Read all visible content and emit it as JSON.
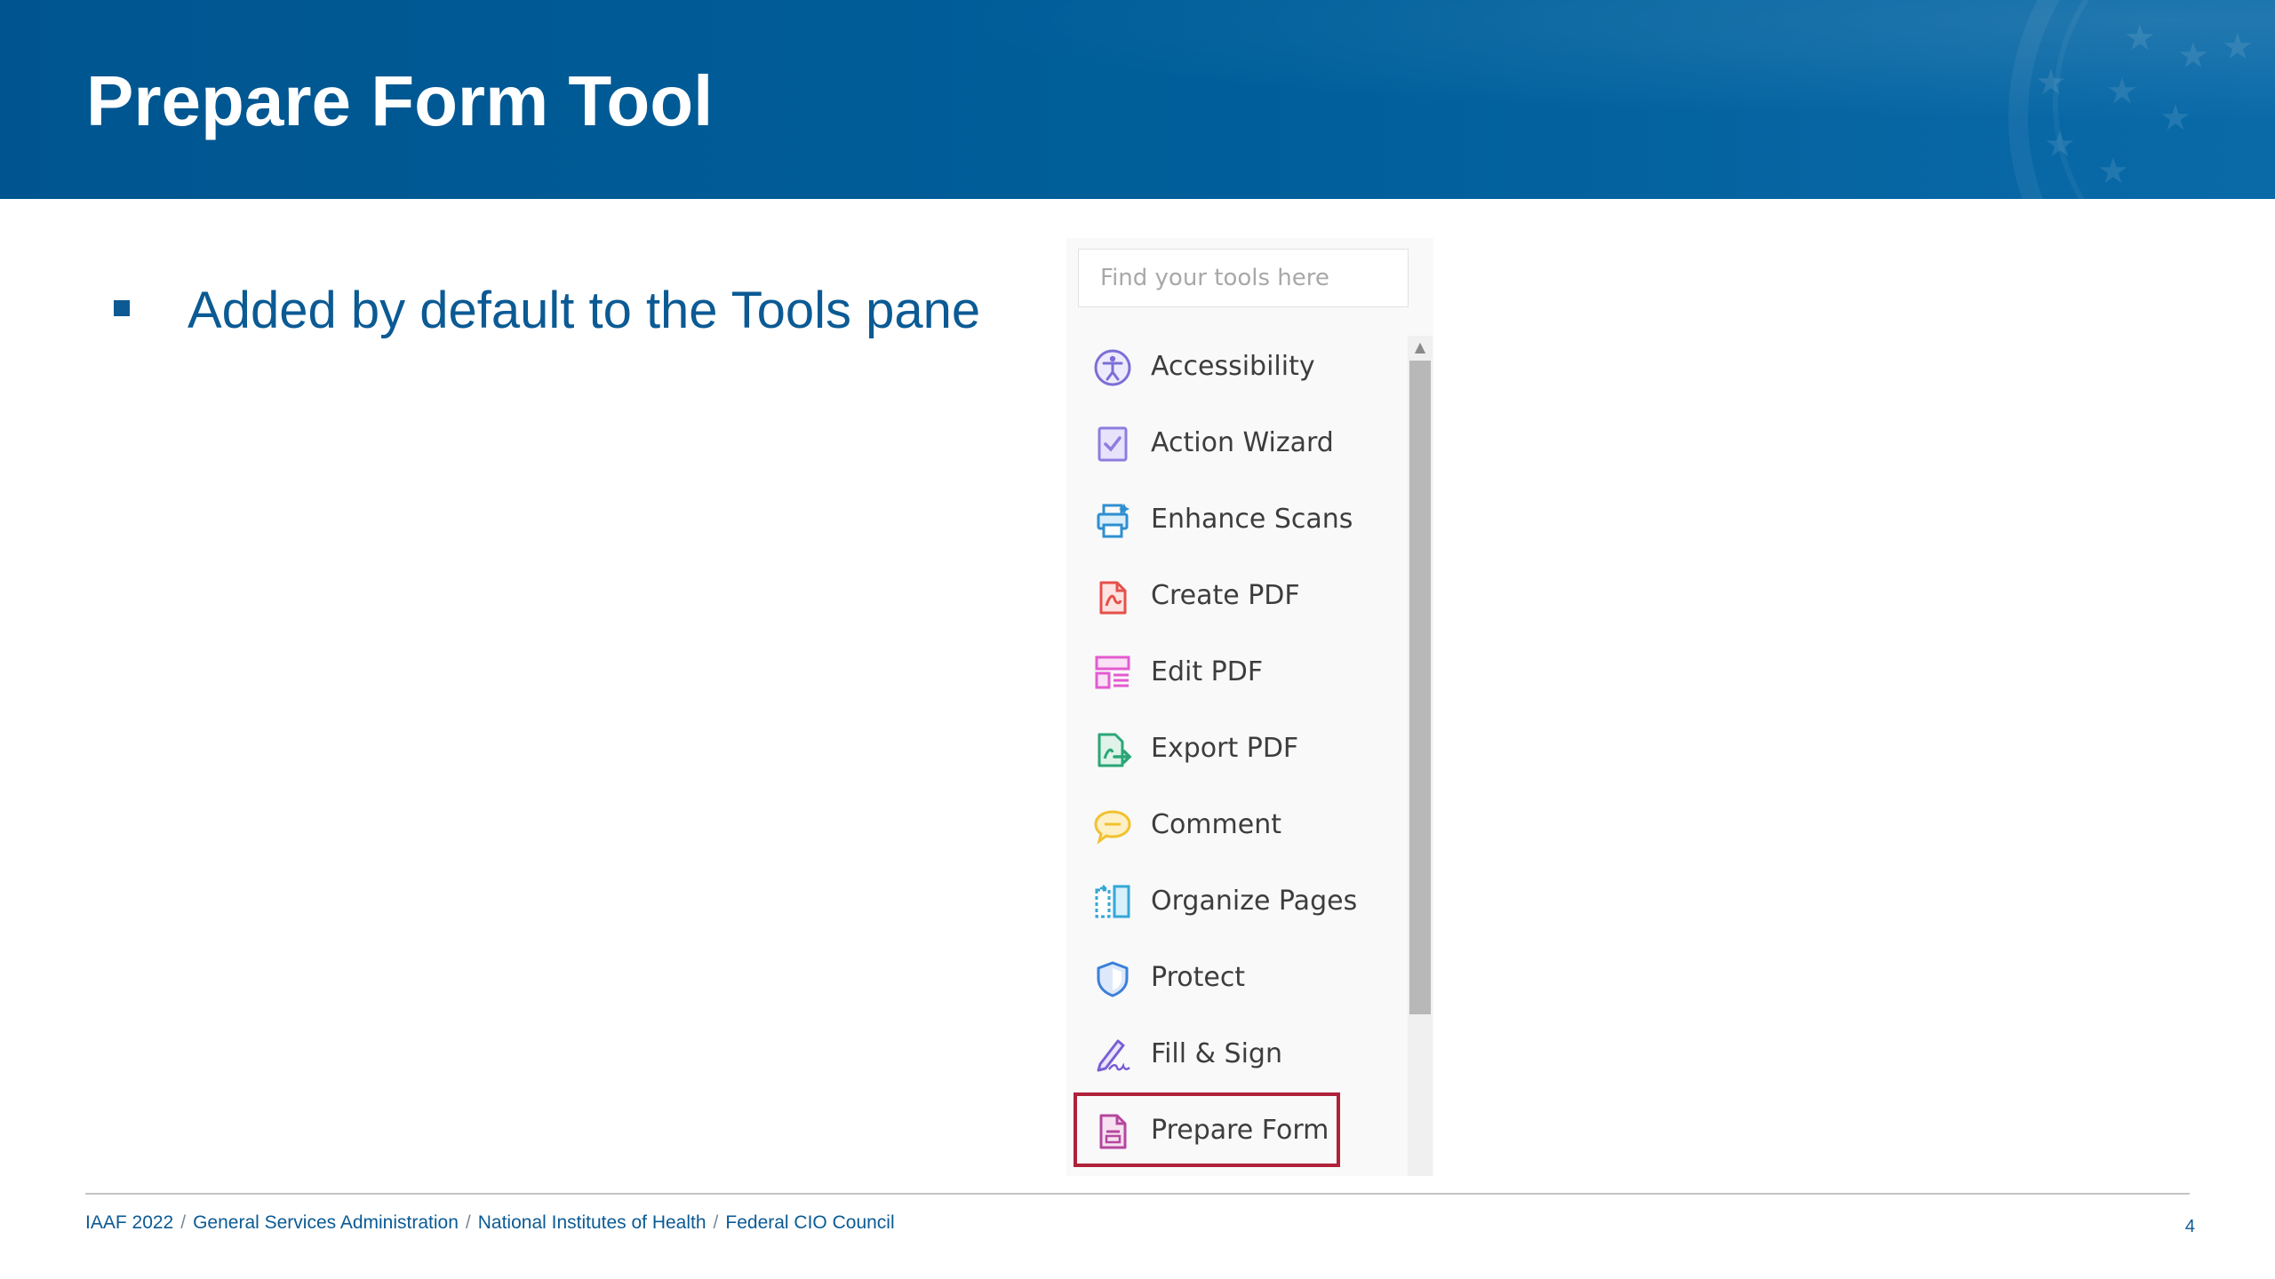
{
  "slide": {
    "title": "Prepare Form Tool",
    "bullet": "Added by default to the Tools pane",
    "page_number": "4"
  },
  "tools_pane": {
    "search_placeholder": "Find your tools here",
    "items": [
      {
        "label": "Accessibility",
        "icon": "accessibility-icon",
        "color": "#7b6fd6"
      },
      {
        "label": "Action Wizard",
        "icon": "action-wizard-icon",
        "color": "#8e7de0"
      },
      {
        "label": "Enhance Scans",
        "icon": "enhance-scans-icon",
        "color": "#2e8fd0"
      },
      {
        "label": "Create PDF",
        "icon": "create-pdf-icon",
        "color": "#e5504a"
      },
      {
        "label": "Edit PDF",
        "icon": "edit-pdf-icon",
        "color": "#e45bd0"
      },
      {
        "label": "Export PDF",
        "icon": "export-pdf-icon",
        "color": "#2aa676"
      },
      {
        "label": "Comment",
        "icon": "comment-icon",
        "color": "#f2c12e"
      },
      {
        "label": "Organize Pages",
        "icon": "organize-pages-icon",
        "color": "#34a7d6"
      },
      {
        "label": "Protect",
        "icon": "protect-icon",
        "color": "#3b7fd8"
      },
      {
        "label": "Fill & Sign",
        "icon": "fill-sign-icon",
        "color": "#7a5ed6"
      },
      {
        "label": "Prepare Form",
        "icon": "prepare-form-icon",
        "color": "#b5479e",
        "highlighted": true
      }
    ],
    "highlight_color": "#b0213a"
  },
  "footer": {
    "items": [
      "IAAF 2022",
      "General Services Administration",
      "National Institutes of Health",
      "Federal CIO Council"
    ],
    "separator": "/"
  }
}
